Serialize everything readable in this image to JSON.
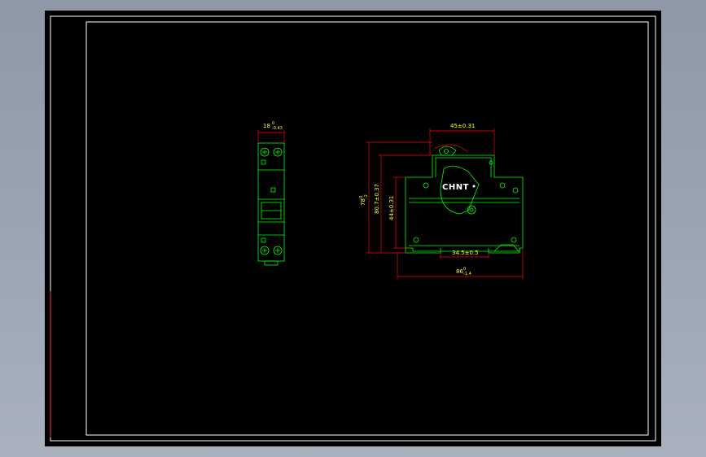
{
  "colors": {
    "background": "#000000",
    "frame": "#ffffff",
    "outline": "#00ff00",
    "dimension": "#ff0000",
    "dimension_text": "#ffff00",
    "brand": "#ffffff"
  },
  "front_view": {
    "width_dim": {
      "main": "18",
      "tol_upper": "0",
      "tol_lower": "-0.43"
    }
  },
  "side_view": {
    "brand": "CHNT",
    "top_width_dim": "45±0.31",
    "overall_height_dim": {
      "main": "78",
      "tol_upper": "0",
      "tol_lower": "-2"
    },
    "height_dim_2": "80.7±0.37",
    "height_dim_3": "44±0.31",
    "rail_width_dim": "34.5±0.5",
    "depth_dim": {
      "main": "86",
      "tol_upper": "0",
      "tol_lower": "-1.4"
    }
  }
}
